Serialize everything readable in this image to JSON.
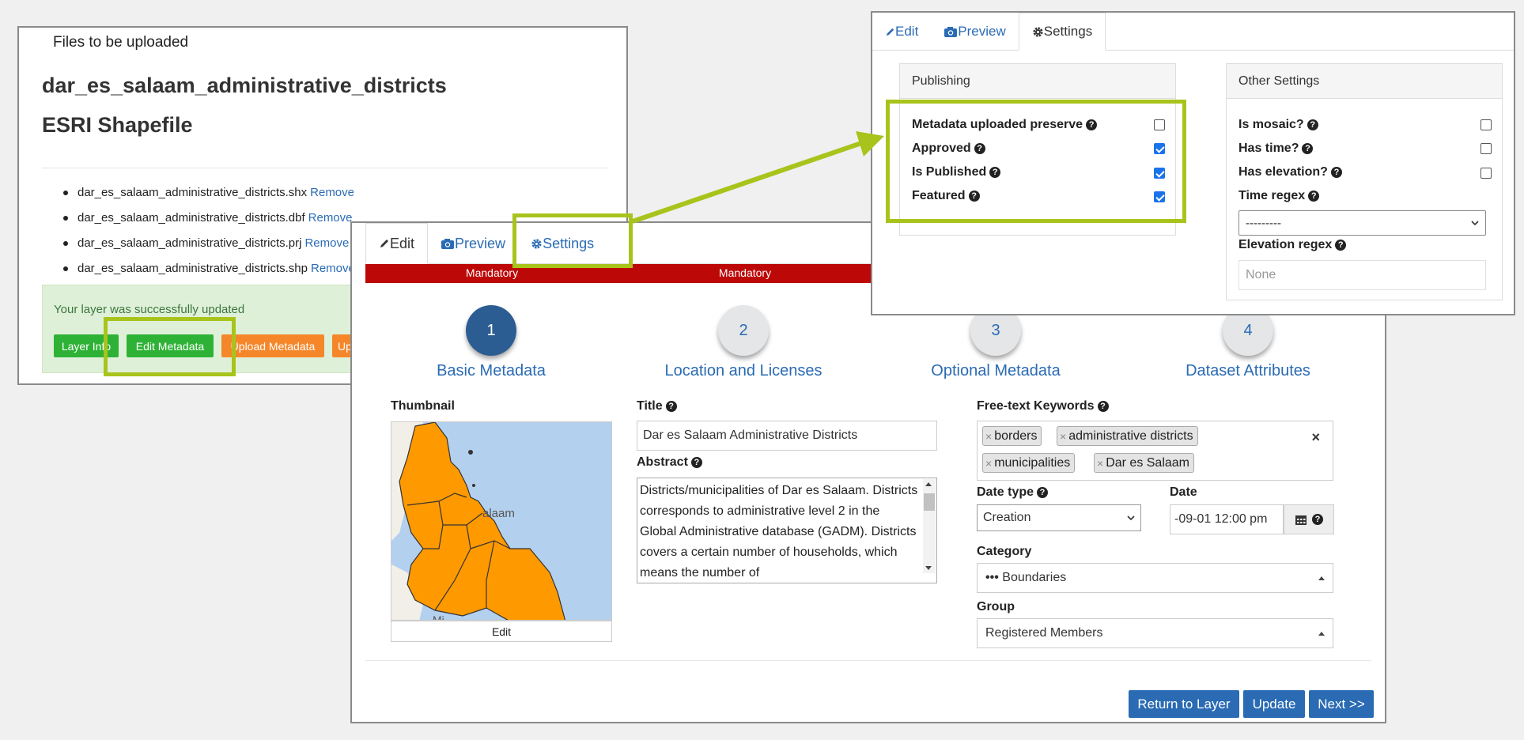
{
  "upload": {
    "files_title": "Files to be uploaded",
    "layer_name": "dar_es_salaam_administrative_districts",
    "file_type": "ESRI Shapefile",
    "files": [
      {
        "name": "dar_es_salaam_administrative_districts.shx",
        "action": "Remove"
      },
      {
        "name": "dar_es_salaam_administrative_districts.dbf",
        "action": "Remove"
      },
      {
        "name": "dar_es_salaam_administrative_districts.prj",
        "action": "Remove"
      },
      {
        "name": "dar_es_salaam_administrative_districts.shp",
        "action": "Remove"
      }
    ],
    "success_msg": "Your layer was successfully updated",
    "buttons": {
      "layer_info": "Layer Info",
      "edit_metadata": "Edit Metadata",
      "upload_metadata": "Upload Metadata",
      "upload_more": "Up"
    }
  },
  "wizard": {
    "tabs": [
      "Edit",
      "Preview",
      "Settings"
    ],
    "mandatory": [
      "Mandatory",
      "Mandatory"
    ],
    "steps": [
      {
        "num": "1",
        "label": "Basic Metadata"
      },
      {
        "num": "2",
        "label": "Location and Licenses"
      },
      {
        "num": "3",
        "label": "Optional Metadata"
      },
      {
        "num": "4",
        "label": "Dataset Attributes"
      }
    ],
    "thumbnail_label": "Thumbnail",
    "thumbnail_map_text": "alaam",
    "thumbnail_map_text2": "Mi",
    "thumbnail_edit": "Edit",
    "title_label": "Title",
    "title_value": "Dar es Salaam Administrative Districts",
    "abstract_label": "Abstract",
    "abstract_value": "Districts/municipalities of Dar es Salaam. Districts corresponds to administrative level 2 in the Global Administrative database (GADM). Districts covers a certain number of households, which means the number of",
    "keywords_label": "Free-text Keywords",
    "keywords": [
      "borders",
      "administrative districts",
      "municipalities",
      "Dar es Salaam"
    ],
    "keywords_clear": "×",
    "date_type_label": "Date type",
    "date_type_value": "Creation",
    "date_label": "Date",
    "date_value": "-09-01 12:00 pm",
    "category_label": "Category",
    "category_value": "Boundaries",
    "group_label": "Group",
    "group_value": "Registered Members",
    "actions": {
      "return": "Return to Layer",
      "update": "Update",
      "next": "Next >>"
    }
  },
  "settings": {
    "tabs": [
      "Edit",
      "Preview",
      "Settings"
    ],
    "publishing_title": "Publishing",
    "publishing": [
      {
        "label": "Metadata uploaded preserve",
        "checked": false
      },
      {
        "label": "Approved",
        "checked": true
      },
      {
        "label": "Is Published",
        "checked": true
      },
      {
        "label": "Featured",
        "checked": true
      }
    ],
    "other_title": "Other Settings",
    "other": [
      {
        "label": "Is mosaic?",
        "checked": false
      },
      {
        "label": "Has time?",
        "checked": false
      },
      {
        "label": "Has elevation?",
        "checked": false
      }
    ],
    "time_regex_label": "Time regex",
    "time_regex_value": "---------",
    "elevation_regex_label": "Elevation regex",
    "elevation_regex_placeholder": "None"
  },
  "colors": {
    "highlight": "#a8c41c",
    "link": "#2a6bb4",
    "mandatory": "#bd0808",
    "step_active": "#2c5d92",
    "map_land": "#ff9900",
    "map_water": "#b3d0ef"
  }
}
